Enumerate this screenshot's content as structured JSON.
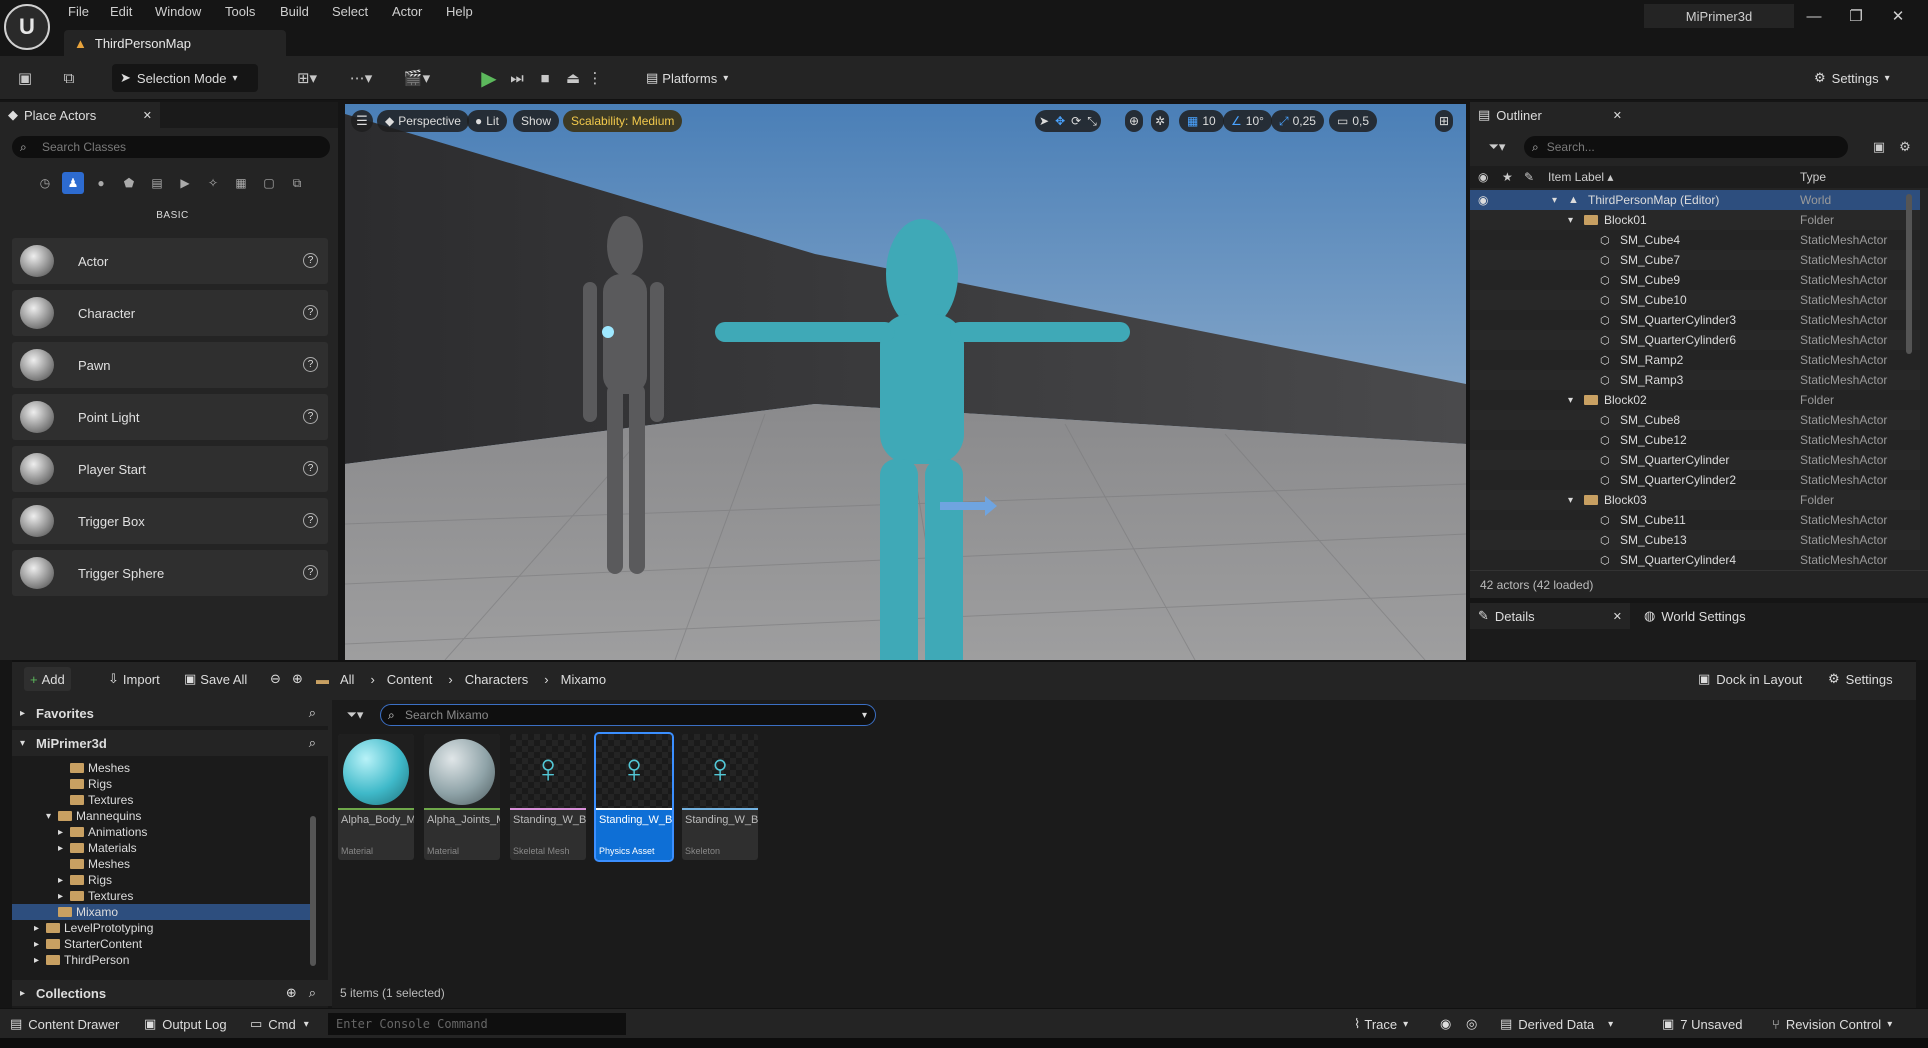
{
  "menu": [
    "File",
    "Edit",
    "Window",
    "Tools",
    "Build",
    "Select",
    "Actor",
    "Help"
  ],
  "project_name": "MiPrimer3d",
  "map_tab": "ThirdPersonMap",
  "window_controls": {
    "minimize": "—",
    "maximize": "❐",
    "close": "✕"
  },
  "toolbar": {
    "selection_mode": "Selection Mode",
    "platforms": "Platforms",
    "settings": "Settings"
  },
  "place_actors": {
    "tab": "Place Actors",
    "search_placeholder": "Search Classes",
    "category": "BASIC",
    "items": [
      "Actor",
      "Character",
      "Pawn",
      "Point Light",
      "Player Start",
      "Trigger Box",
      "Trigger Sphere"
    ],
    "help_glyph": "?"
  },
  "viewport": {
    "perspective": "Perspective",
    "lit": "Lit",
    "show": "Show",
    "scalability": "Scalability: Medium",
    "grid": "10",
    "rotation": "10°",
    "scale": "0,25",
    "camera_speed": "0,5"
  },
  "outliner": {
    "tab": "Outliner",
    "search_placeholder": "Search...",
    "col_label": "Item Label ▴",
    "col_type": "Type",
    "rows": [
      {
        "label": "ThirdPersonMap (Editor)",
        "type": "World",
        "indent": 0,
        "kind": "world"
      },
      {
        "label": "Block01",
        "type": "Folder",
        "indent": 1,
        "kind": "folder"
      },
      {
        "label": "SM_Cube4",
        "type": "StaticMeshActor",
        "indent": 2,
        "kind": "mesh"
      },
      {
        "label": "SM_Cube7",
        "type": "StaticMeshActor",
        "indent": 2,
        "kind": "mesh"
      },
      {
        "label": "SM_Cube9",
        "type": "StaticMeshActor",
        "indent": 2,
        "kind": "mesh"
      },
      {
        "label": "SM_Cube10",
        "type": "StaticMeshActor",
        "indent": 2,
        "kind": "mesh"
      },
      {
        "label": "SM_QuarterCylinder3",
        "type": "StaticMeshActor",
        "indent": 2,
        "kind": "mesh"
      },
      {
        "label": "SM_QuarterCylinder6",
        "type": "StaticMeshActor",
        "indent": 2,
        "kind": "mesh"
      },
      {
        "label": "SM_Ramp2",
        "type": "StaticMeshActor",
        "indent": 2,
        "kind": "mesh"
      },
      {
        "label": "SM_Ramp3",
        "type": "StaticMeshActor",
        "indent": 2,
        "kind": "mesh"
      },
      {
        "label": "Block02",
        "type": "Folder",
        "indent": 1,
        "kind": "folder"
      },
      {
        "label": "SM_Cube8",
        "type": "StaticMeshActor",
        "indent": 2,
        "kind": "mesh"
      },
      {
        "label": "SM_Cube12",
        "type": "StaticMeshActor",
        "indent": 2,
        "kind": "mesh"
      },
      {
        "label": "SM_QuarterCylinder",
        "type": "StaticMeshActor",
        "indent": 2,
        "kind": "mesh"
      },
      {
        "label": "SM_QuarterCylinder2",
        "type": "StaticMeshActor",
        "indent": 2,
        "kind": "mesh"
      },
      {
        "label": "Block03",
        "type": "Folder",
        "indent": 1,
        "kind": "folder"
      },
      {
        "label": "SM_Cube11",
        "type": "StaticMeshActor",
        "indent": 2,
        "kind": "mesh"
      },
      {
        "label": "SM_Cube13",
        "type": "StaticMeshActor",
        "indent": 2,
        "kind": "mesh"
      },
      {
        "label": "SM_QuarterCylinder4",
        "type": "StaticMeshActor",
        "indent": 2,
        "kind": "mesh"
      }
    ],
    "footer": "42 actors (42 loaded)"
  },
  "details": {
    "tab": "Details",
    "world_settings": "World Settings"
  },
  "content_browser": {
    "add": "Add",
    "import": "Import",
    "save_all": "Save All",
    "breadcrumb": [
      "All",
      "Content",
      "Characters",
      "Mixamo"
    ],
    "dock": "Dock in Layout",
    "settings": "Settings",
    "favorites": "Favorites",
    "project": "MiPrimer3d",
    "collections": "Collections",
    "search_placeholder": "Search Mixamo",
    "tree": [
      {
        "label": "Meshes",
        "indent": 3,
        "arrow": "",
        "sel": false
      },
      {
        "label": "Rigs",
        "indent": 3,
        "arrow": "",
        "sel": false
      },
      {
        "label": "Textures",
        "indent": 3,
        "arrow": "",
        "sel": false
      },
      {
        "label": "Mannequins",
        "indent": 2,
        "arrow": "▾",
        "sel": false
      },
      {
        "label": "Animations",
        "indent": 3,
        "arrow": "▸",
        "sel": false
      },
      {
        "label": "Materials",
        "indent": 3,
        "arrow": "▸",
        "sel": false
      },
      {
        "label": "Meshes",
        "indent": 3,
        "arrow": "",
        "sel": false
      },
      {
        "label": "Rigs",
        "indent": 3,
        "arrow": "▸",
        "sel": false
      },
      {
        "label": "Textures",
        "indent": 3,
        "arrow": "▸",
        "sel": false
      },
      {
        "label": "Mixamo",
        "indent": 2,
        "arrow": "",
        "sel": true
      },
      {
        "label": "LevelPrototyping",
        "indent": 1,
        "arrow": "▸",
        "sel": false
      },
      {
        "label": "StarterContent",
        "indent": 1,
        "arrow": "▸",
        "sel": false
      },
      {
        "label": "ThirdPerson",
        "indent": 1,
        "arrow": "▸",
        "sel": false
      }
    ],
    "assets": [
      {
        "name": "Alpha_Body_MAT",
        "kind": "Material",
        "thumb": "sphere-teal",
        "bar": "#6fa84a",
        "sel": false
      },
      {
        "name": "Alpha_Joints_MAT",
        "kind": "Material",
        "thumb": "sphere-grey",
        "bar": "#6fa84a",
        "sel": false
      },
      {
        "name": "Standing_W_Briefcase_Idle",
        "kind": "Skeletal Mesh",
        "thumb": "figure",
        "bar": "#d88fd8",
        "sel": false
      },
      {
        "name": "Standing_W_Briefcase_Idle_PhysicsAsset",
        "kind": "Physics Asset",
        "thumb": "figure",
        "bar": "#ffffff",
        "sel": true
      },
      {
        "name": "Standing_W_Briefcase_Idle_Skeleton",
        "kind": "Skeleton",
        "thumb": "figure",
        "bar": "#73b2e0",
        "sel": false
      }
    ],
    "status": "5 items (1 selected)"
  },
  "statusbar": {
    "content_drawer": "Content Drawer",
    "output_log": "Output Log",
    "cmd": "Cmd",
    "console_placeholder": "Enter Console Command",
    "trace": "Trace",
    "derived_data": "Derived Data",
    "unsaved": "7 Unsaved",
    "revision": "Revision Control"
  }
}
